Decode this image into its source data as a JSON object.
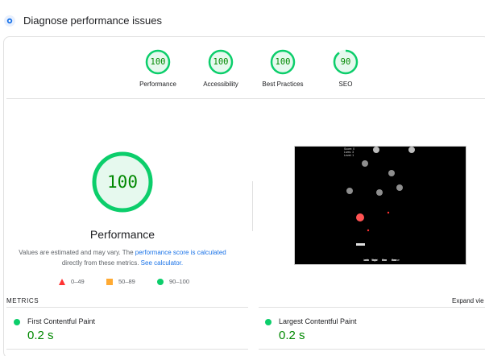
{
  "header": {
    "title": "Diagnose performance issues",
    "icon": "lighthouse-icon"
  },
  "summary_gauges": [
    {
      "score": "100",
      "label": "Performance",
      "status": "pass",
      "color": "#0cce6b"
    },
    {
      "score": "100",
      "label": "Accessibility",
      "status": "pass",
      "color": "#0cce6b"
    },
    {
      "score": "100",
      "label": "Best Practices",
      "status": "pass",
      "color": "#0cce6b"
    },
    {
      "score": "90",
      "label": "SEO",
      "status": "pass",
      "color": "#0cce6b"
    }
  ],
  "performance": {
    "score": "100",
    "label": "Performance",
    "note_prefix": "Values are estimated and may vary. The ",
    "note_link1": "performance score is calculated",
    "note_middle": "directly from these metrics. ",
    "note_link2": "See calculator."
  },
  "legend": [
    {
      "range": "0–49",
      "shape": "triangle",
      "color": "#ff3333"
    },
    {
      "range": "50–89",
      "shape": "square",
      "color": "#ffaa33"
    },
    {
      "range": "90–100",
      "shape": "circle",
      "color": "#0cce6b"
    }
  ],
  "screenshot": {
    "description_icon": "game-screenshot-thumbnail",
    "hud_lines": [
      "Score: 0",
      "Lives: 3",
      "Level: 1"
    ],
    "footer_buttons": [
      "Left",
      "Right",
      "Fire",
      "Pause"
    ]
  },
  "metrics": {
    "title": "METRICS",
    "expand_label": "Expand vie",
    "items": [
      {
        "name": "First Contentful Paint",
        "value": "0.2 s",
        "status": "pass"
      },
      {
        "name": "Largest Contentful Paint",
        "value": "0.2 s",
        "status": "pass"
      }
    ]
  },
  "colors": {
    "pass": "#0cce6b",
    "pass_text": "#008800",
    "pass_fill": "#e6f9ee",
    "link": "#1a73e8"
  }
}
